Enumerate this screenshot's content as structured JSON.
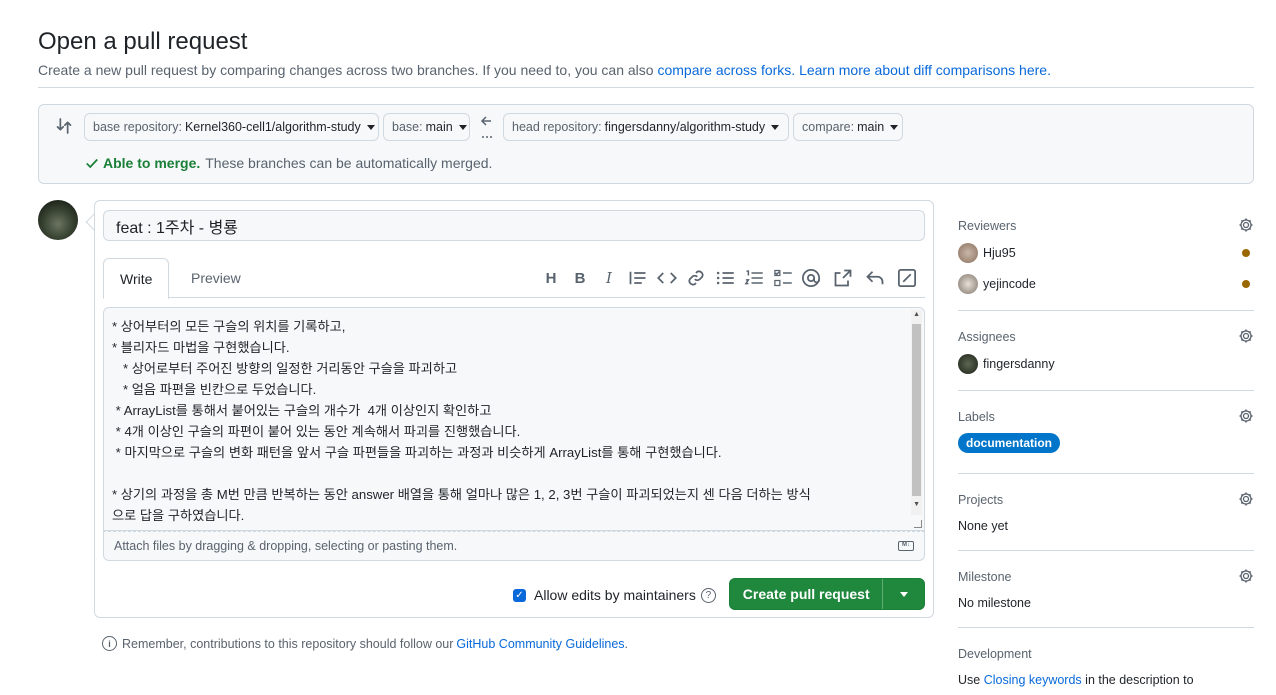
{
  "header": {
    "title": "Open a pull request",
    "subtitle": "Create a new pull request by comparing changes across two branches. If you need to, you can also",
    "link_forks": "compare across forks.",
    "link_learn": "Learn more about diff comparisons here."
  },
  "compare": {
    "base_repo_label": "base repository:",
    "base_repo_value": "Kernel360-cell1/algorithm-study",
    "base_label": "base:",
    "base_value": "main",
    "head_repo_label": "head repository:",
    "head_repo_value": "fingersdanny/algorithm-study",
    "compare_label": "compare:",
    "compare_value": "main",
    "merge_ok": "Able to merge.",
    "merge_msg": "These branches can be automatically merged."
  },
  "form": {
    "title_value": "feat : 1주차 - 병룡",
    "tabs": {
      "write": "Write",
      "preview": "Preview"
    },
    "body_lines": [
      "* 상어부터의 모든 구슬의 위치를 기록하고,",
      "* 블리자드 마법을 구현했습니다.",
      "   * 상어로부터 주어진 방향의 일정한 거리동안 구슬을 파괴하고",
      "   * 얼음 파편을 빈칸으로 두었습니다.",
      " * ArrayList를 통해서 붙어있는 구슬의 개수가  4개 이상인지 확인하고",
      " * 4개 이상인 구슬의 파편이 붙어 있는 동안 계속해서 파괴를 진행했습니다.",
      " * 마지막으로 구슬의 변화 패턴을 앞서 구슬 파편들을 파괴하는 과정과 비슷하게 ArrayList를 통해 구현했습니다.",
      "",
      "* 상기의 과정을 총 M번 만큼 반복하는 동안 answer 배열을 통해 얼마나 많은 1, 2, 3번 구슬이 파괴되었는지 센 다음 더하는 방식",
      "으로 답을 구하였습니다."
    ],
    "attach_hint": "Attach files by dragging & dropping, selecting or pasting them.",
    "md_badge": "M↓",
    "allow_edits": "Allow edits by maintainers",
    "create_button": "Create pull request"
  },
  "footer": {
    "remember": "Remember, contributions to this repository should follow our",
    "guidelines": "GitHub Community Guidelines",
    "period": "."
  },
  "sidebar": {
    "reviewers": {
      "title": "Reviewers",
      "people": [
        "Hju95",
        "yejincode"
      ]
    },
    "assignees": {
      "title": "Assignees",
      "people": [
        "fingersdanny"
      ]
    },
    "labels": {
      "title": "Labels",
      "label": "documentation",
      "label_color": "#0075ca"
    },
    "projects": {
      "title": "Projects",
      "value": "None yet"
    },
    "milestone": {
      "title": "Milestone",
      "value": "No milestone"
    },
    "development": {
      "title": "Development",
      "text_pre": "Use",
      "link": "Closing keywords",
      "text_post": "in the description to"
    }
  },
  "colors": {
    "accent": "#0969da",
    "success": "#1f883d",
    "pending": "#9a6700"
  },
  "icons": [
    "compare-icon",
    "arrow-left-icon",
    "check-icon",
    "heading-icon",
    "bold-icon",
    "italic-icon",
    "quote-icon",
    "code-icon",
    "link-icon",
    "unordered-list-icon",
    "ordered-list-icon",
    "task-list-icon",
    "mention-icon",
    "cross-reference-icon",
    "reply-icon",
    "fullscreen-icon",
    "markdown-icon",
    "help-icon",
    "info-icon",
    "gear-icon",
    "caret-down-icon"
  ]
}
